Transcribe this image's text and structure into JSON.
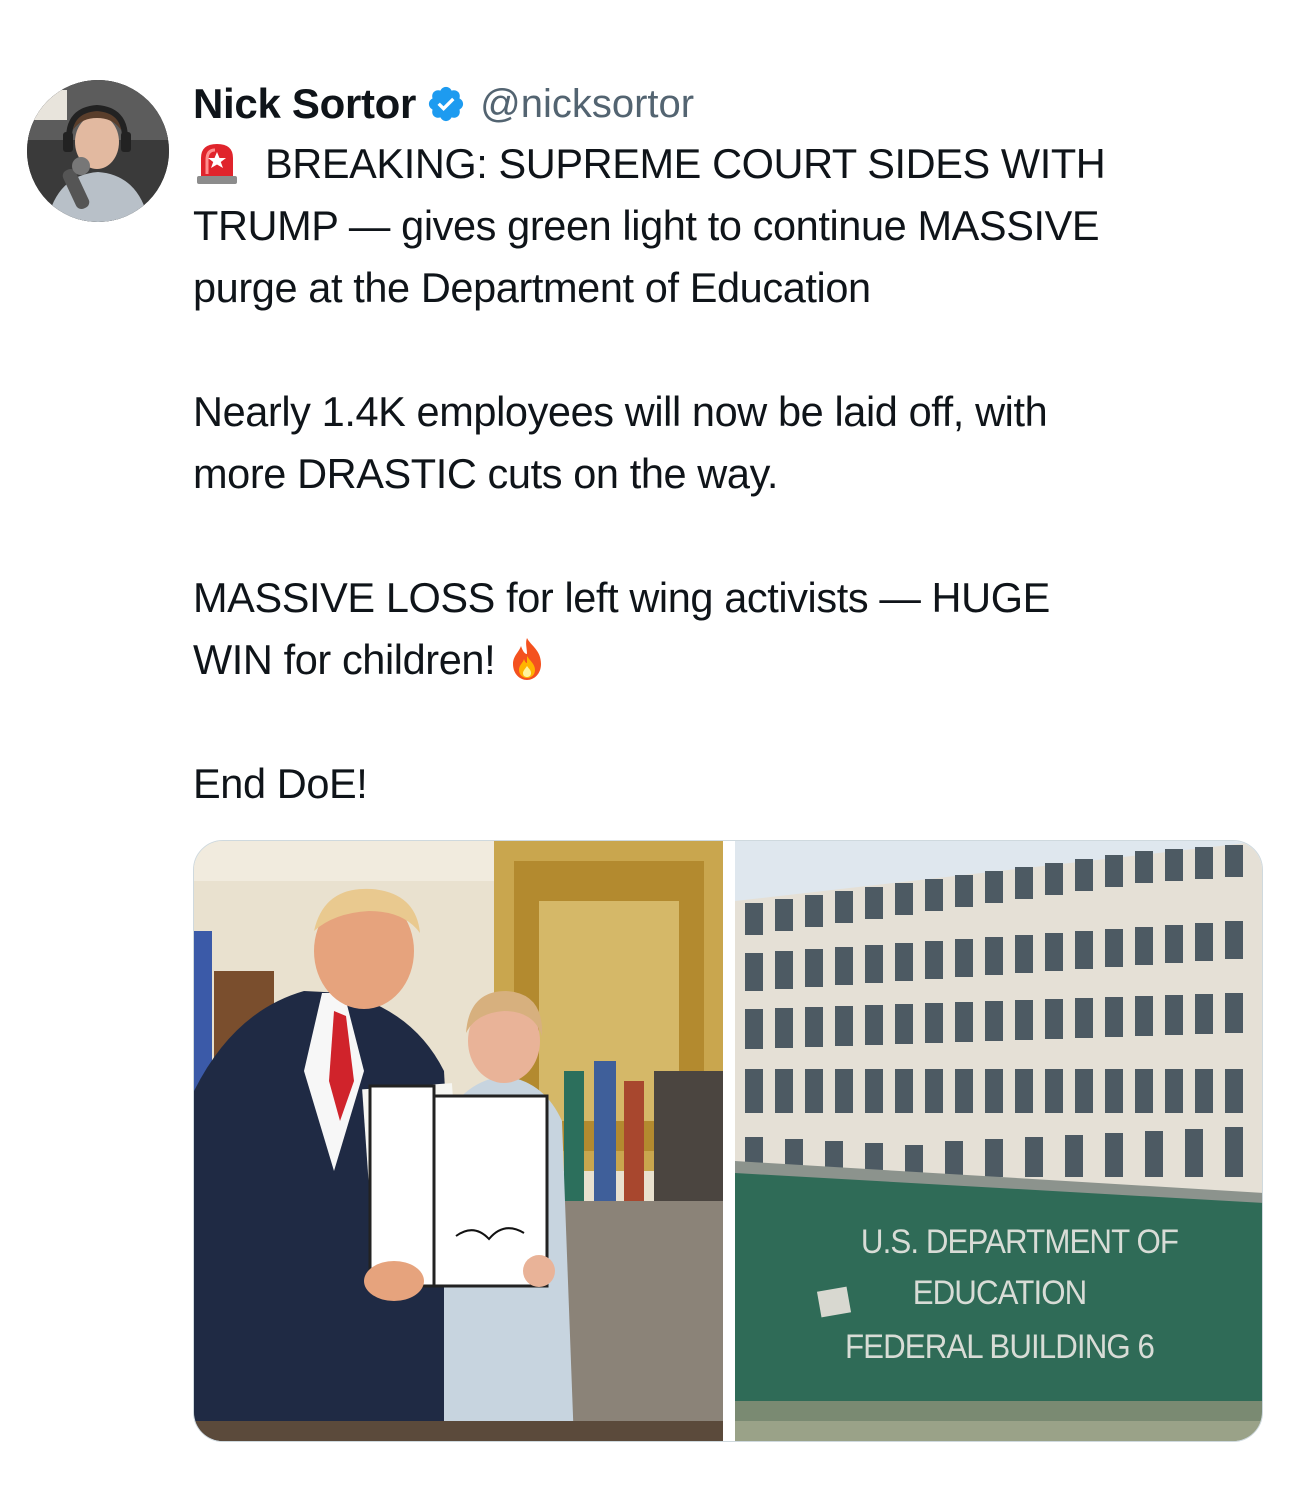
{
  "author": {
    "display_name": "Nick Sortor",
    "handle": "@nicksortor",
    "verified": true,
    "avatar_icon": "profile-photo"
  },
  "tweet": {
    "line_1": "BREAKING: SUPREME COURT SIDES WITH",
    "line_2": "TRUMP — gives green light to continue MASSIVE",
    "line_3": "purge at the Department of Education",
    "line_4": "Nearly 1.4K employees will now be laid off, with",
    "line_5": "more DRASTIC cuts on the way.",
    "line_6": "MASSIVE LOSS for left wing activists — HUGE",
    "line_7": "WIN for children!",
    "line_8": "End DoE!",
    "siren_emoji": "rotating-light-emoji",
    "fire_emoji": "fire-emoji"
  },
  "media": {
    "image_1": "photo-signing-ceremony",
    "image_2": "photo-department-of-education-building",
    "sign_line_1": "U.S. DEPARTMENT OF",
    "sign_line_2": "EDUCATION",
    "sign_line_3": "FEDERAL BUILDING 6"
  },
  "colors": {
    "text": "#0f1419",
    "handle": "#536471",
    "verified": "#1d9bf0"
  }
}
